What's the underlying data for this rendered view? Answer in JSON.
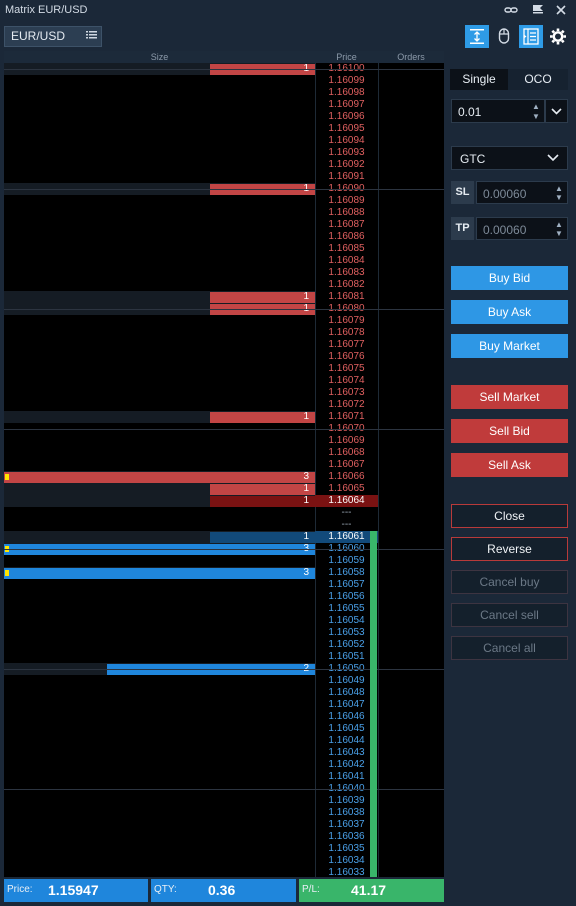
{
  "window": {
    "title": "Matrix EUR/USD"
  },
  "symbol": {
    "name": "EUR/USD"
  },
  "icons": [
    "link-icon",
    "flag-menu-icon",
    "close-icon",
    "vertical-resize-icon",
    "mouse-icon",
    "ladder-layout-icon",
    "gear-icon",
    "list-icon"
  ],
  "ladder": {
    "headers": {
      "size": "Size",
      "price": "Price",
      "orders": "Orders"
    },
    "ask_prices": [
      "1.16100",
      "1.16099",
      "1.16098",
      "1.16097",
      "1.16096",
      "1.16095",
      "1.16094",
      "1.16093",
      "1.16092",
      "1.16091",
      "1.16090",
      "1.16089",
      "1.16088",
      "1.16087",
      "1.16086",
      "1.16085",
      "1.16084",
      "1.16083",
      "1.16082",
      "1.16081",
      "1.16080",
      "1.16079",
      "1.16078",
      "1.16077",
      "1.16076",
      "1.16075",
      "1.16074",
      "1.16073",
      "1.16072",
      "1.16071",
      "1.16070",
      "1.16069",
      "1.16068",
      "1.16067",
      "1.16066",
      "1.16065",
      "1.16064"
    ],
    "spread_rows": [
      "---",
      "---"
    ],
    "bid_prices": [
      "1.16061",
      "1.16060",
      "1.16059",
      "1.16058",
      "1.16057",
      "1.16056",
      "1.16055",
      "1.16054",
      "1.16053",
      "1.16052",
      "1.16051",
      "1.16050",
      "1.16049",
      "1.16048",
      "1.16047",
      "1.16046",
      "1.16045",
      "1.16044",
      "1.16043",
      "1.16042",
      "1.16041",
      "1.16040",
      "1.16039",
      "1.16038",
      "1.16037",
      "1.16036",
      "1.16035",
      "1.16034",
      "1.16033"
    ],
    "ask_sizes": {
      "1.16100": "1",
      "1.16090": "1",
      "1.16081": "1",
      "1.16080": "1",
      "1.16071": "1",
      "1.16066": "3",
      "1.16065": "1",
      "1.16064": "1"
    },
    "bid_sizes": {
      "1.16061": "1",
      "1.16060": "3",
      "1.16058": "3",
      "1.16050": "2"
    },
    "size_max": 3,
    "markers": [
      "1.16066",
      "1.16060",
      "1.16058"
    ]
  },
  "footer": {
    "price_label": "Price:",
    "price_value": "1.15947",
    "qty_label": "QTY:",
    "qty_value": "0.36",
    "pl_label": "P/L:",
    "pl_value": "41.17"
  },
  "panel": {
    "mode_single": "Single",
    "mode_oco": "OCO",
    "quantity": "0.01",
    "tif": "GTC",
    "sl_label": "SL",
    "sl_value": "0.00060",
    "tp_label": "TP",
    "tp_value": "0.00060",
    "buy_bid": "Buy Bid",
    "buy_ask": "Buy Ask",
    "buy_market": "Buy Market",
    "sell_market": "Sell Market",
    "sell_bid": "Sell Bid",
    "sell_ask": "Sell Ask",
    "close": "Close",
    "reverse": "Reverse",
    "cancel_buy": "Cancel buy",
    "cancel_sell": "Cancel sell",
    "cancel_all": "Cancel all"
  },
  "colors": {
    "ask": "#c24545",
    "bid": "#1f86dc",
    "accent": "#2e97e5",
    "pl_green": "#39b56a"
  }
}
